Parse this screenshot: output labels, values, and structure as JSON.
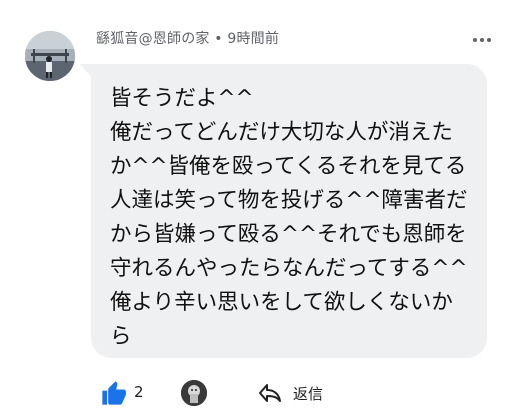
{
  "comment": {
    "author": "繇狐音@恩師の家",
    "separator": " • ",
    "time": "9時間前",
    "lines": [
      "皆そうだよ^^",
      "俺だってどんだけ大切な人が消えた",
      "か^^皆俺を殴ってくるそれを見てる",
      "人達は笑って物を投げる^^障害者だ",
      "から皆嫌って殴る^^それでも恩師を",
      "守れるんやったらなんだってする^^",
      "俺より辛い思いをして欲しくないか",
      "ら"
    ]
  },
  "actions": {
    "like_count": "2",
    "reply_label": "返信"
  },
  "icons": {
    "more": "more-vert-icon",
    "like": "thumbs-up-icon",
    "creator_heart": "creator-heart-icon",
    "reply": "reply-arrow-icon"
  },
  "colors": {
    "like_blue": "#1a73e8",
    "bubble_bg": "#eef0f2",
    "meta_text": "#5f6368"
  }
}
